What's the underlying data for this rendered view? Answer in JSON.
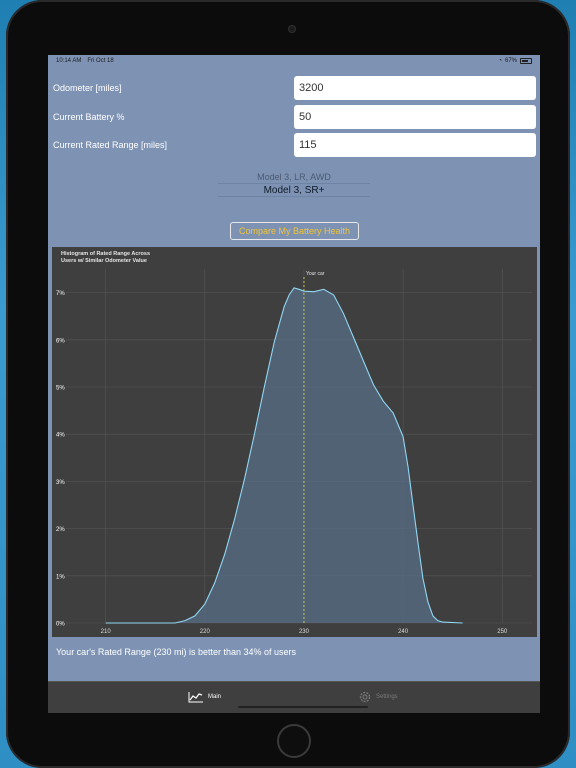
{
  "status_bar": {
    "time": "10:14 AM",
    "date": "Fri Oct 18",
    "battery": "67%",
    "wifi_icon": "wifi-icon",
    "battery_icon": "battery-icon"
  },
  "form": {
    "odometer": {
      "label": "Odometer [miles]",
      "value": "3200"
    },
    "battery_pct": {
      "label": "Current Battery %",
      "value": "50"
    },
    "rated_range": {
      "label": "Current Rated Range [miles]",
      "value": "115"
    }
  },
  "model_picker": {
    "options": [
      "Model 3, LR, AWD",
      "Model 3, SR+"
    ],
    "selected": "Model 3, SR+"
  },
  "compare_button": {
    "label": "Compare My Battery Health"
  },
  "chart_data": {
    "type": "area",
    "title_line1": "Histogram of Rated Range Across",
    "title_line2": "Users w/ Similar Odometer Value",
    "marker_label": "Your car",
    "marker_x": 230,
    "xlim": [
      206,
      253
    ],
    "ylim": [
      0,
      7.5
    ],
    "x_ticks": [
      210,
      220,
      230,
      240,
      250
    ],
    "y_ticks": [
      0,
      1,
      2,
      3,
      4,
      5,
      6,
      7
    ],
    "y_tick_labels": [
      "0%",
      "1%",
      "2%",
      "3%",
      "4%",
      "5%",
      "6%",
      "7%"
    ],
    "grid": true,
    "x": [
      210,
      214,
      217,
      218,
      219,
      220,
      221,
      222,
      223,
      224,
      225,
      226,
      227,
      228,
      228.5,
      229,
      229.5,
      230,
      231,
      232,
      233,
      234,
      235,
      236,
      237,
      238,
      239,
      240,
      240.5,
      241,
      241.5,
      242,
      242.5,
      243,
      243.5,
      244,
      246
    ],
    "y": [
      0,
      0,
      0,
      0.05,
      0.15,
      0.4,
      0.85,
      1.45,
      2.2,
      3.05,
      4.0,
      5.0,
      5.95,
      6.7,
      6.95,
      7.1,
      7.07,
      7.03,
      7.02,
      7.07,
      6.95,
      6.55,
      6.05,
      5.55,
      5.05,
      4.7,
      4.45,
      3.95,
      3.3,
      2.5,
      1.7,
      0.95,
      0.45,
      0.15,
      0.05,
      0.02,
      0
    ]
  },
  "result_text": "Your car's Rated Range (230 mi) is better than 34% of users",
  "tabs": [
    {
      "label": "Main",
      "icon": "line-chart-icon",
      "active": true
    },
    {
      "label": "Settings",
      "icon": "gear-icon",
      "active": false
    }
  ],
  "colors": {
    "screen_bg": "#7e93b3",
    "chart_bg": "#3f3f3f",
    "curve": "#8fd7f3",
    "marker": "#d4d24a",
    "button_text": "#f2c333"
  }
}
